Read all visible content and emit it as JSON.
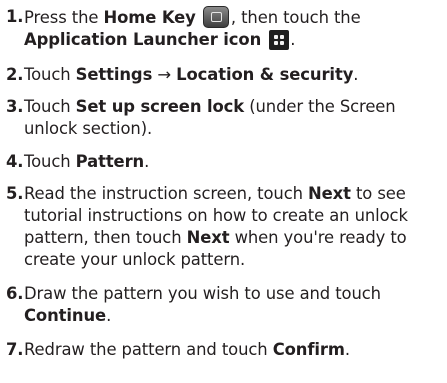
{
  "steps": [
    {
      "num": "1.",
      "pre": "Press the ",
      "b1": "Home Key",
      "mid": ", then touch the",
      "b2": "Application Launcher icon",
      "end": "."
    },
    {
      "num": "2.",
      "pre": "Touch ",
      "b1": "Settings",
      "arrow": "→",
      "b2": "Location & security",
      "end": "."
    },
    {
      "num": "3.",
      "pre": "Touch ",
      "b1": "Set up screen lock",
      "post": " (under the Screen unlock section)."
    },
    {
      "num": "4.",
      "pre": "Touch ",
      "b1": "Pattern",
      "end": "."
    },
    {
      "num": "5.",
      "pre": "Read the instruction screen, touch ",
      "b1": "Next",
      "mid": " to see tutorial instructions on how to create an unlock pattern, then touch ",
      "b2": "Next",
      "post": " when you're ready to create your unlock pattern."
    },
    {
      "num": "6.",
      "pre": "Draw the pattern you wish to use and touch ",
      "b1": "Continue",
      "end": "."
    },
    {
      "num": "7.",
      "pre": "Redraw the pattern and touch ",
      "b1": "Confirm",
      "end": "."
    }
  ],
  "icons": {
    "home_key": "home-key-icon",
    "app_launcher": "application-launcher-icon"
  }
}
